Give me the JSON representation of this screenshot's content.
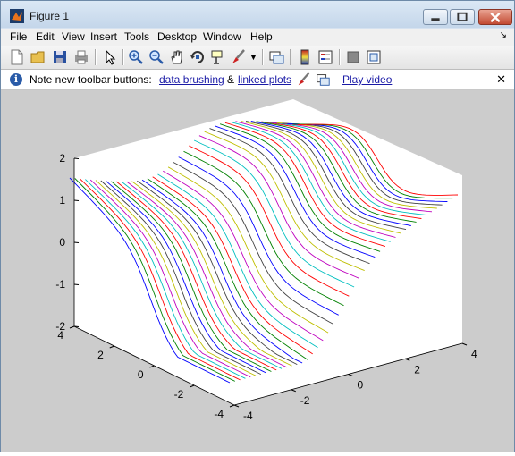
{
  "window": {
    "title": "Figure 1"
  },
  "menu": [
    "File",
    "Edit",
    "View",
    "Insert",
    "Tools",
    "Desktop",
    "Window",
    "Help"
  ],
  "toolbar": {
    "buttons": [
      "new-figure",
      "open-file",
      "save-figure",
      "print-figure",
      "edit-plot",
      "zoom-in",
      "zoom-out",
      "pan",
      "rotate-3d",
      "data-cursor",
      "brush",
      "link-plot",
      "insert-colorbar",
      "insert-legend",
      "hide-plot-tools",
      "show-plot-tools"
    ]
  },
  "infobar": {
    "note": "Note new toolbar buttons:",
    "link_brushing": "data brushing",
    "amp": "&",
    "link_linked": "linked plots",
    "link_video": "Play video",
    "close": "✕"
  },
  "chart_data": {
    "type": "line",
    "plot3d": true,
    "title": "",
    "xlabel": "",
    "ylabel": "",
    "zlabel": "",
    "xlim": [
      -4,
      4
    ],
    "ylim": [
      -4,
      4
    ],
    "zlim": [
      -2,
      2
    ],
    "x_ticks": [
      "-4",
      "-2",
      "0",
      "2",
      "4"
    ],
    "y_ticks": [
      "4",
      "2",
      "0",
      "-2",
      "-4"
    ],
    "z_ticks": [
      "2",
      "1",
      "0",
      "-1",
      "-2"
    ],
    "line_count": 45,
    "colors": [
      "#0000ff",
      "#008000",
      "#ff0000",
      "#00bfbf",
      "#bf00bf",
      "#bfbf00",
      "#404040"
    ],
    "grid": false
  }
}
